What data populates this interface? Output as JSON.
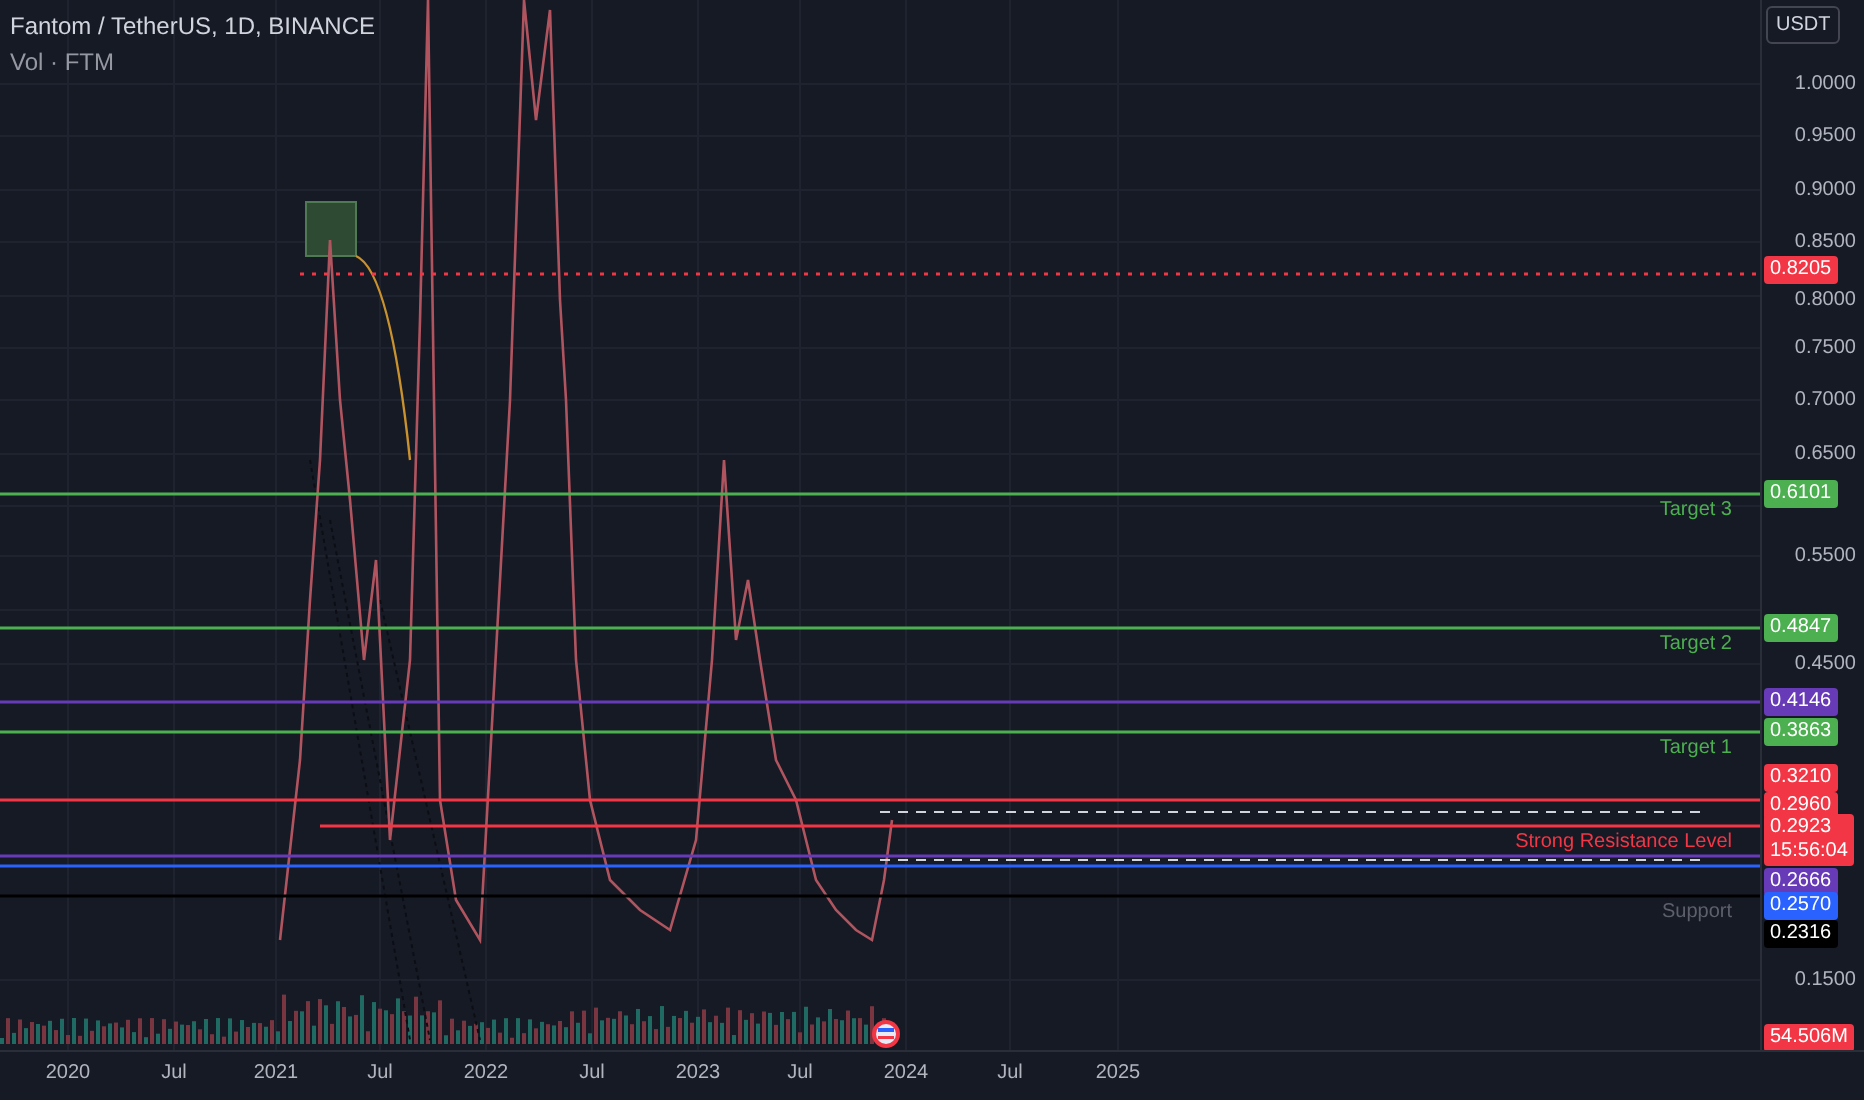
{
  "header": {
    "title": "Fantom / TetherUS, 1D, BINANCE",
    "indicator": "Vol · FTM"
  },
  "currency": "USDT",
  "price_ticks": [
    "1.0000",
    "0.9500",
    "0.9000",
    "0.8500",
    "0.8000",
    "0.7500",
    "0.7000",
    "0.6500",
    "0.5500",
    "0.4500",
    "0.1500"
  ],
  "levels": [
    {
      "price": "0.8205",
      "color": "#f23645",
      "kind": "dotted"
    },
    {
      "price": "0.6101",
      "color": "#4caf50",
      "kind": "solid",
      "caption": "Target 3"
    },
    {
      "price": "0.4847",
      "color": "#4caf50",
      "kind": "solid",
      "caption": "Target 2"
    },
    {
      "price": "0.4146",
      "color": "#673ab7",
      "kind": "solid"
    },
    {
      "price": "0.3863",
      "color": "#4caf50",
      "kind": "solid",
      "caption": "Target 1"
    },
    {
      "price": "0.3210",
      "color": "#f23645",
      "kind": "label"
    },
    {
      "price": "0.2960",
      "color": "#f23645",
      "kind": "solid"
    },
    {
      "price": "0.2923",
      "time": "15:56:04",
      "color": "#f23645",
      "kind": "solid",
      "caption": "Strong Resistance Level"
    },
    {
      "price": "0.2666",
      "color": "#673ab7",
      "kind": "solid"
    },
    {
      "price": "0.2570",
      "color": "#2962ff",
      "kind": "solid"
    },
    {
      "price": "0.2316",
      "color": "#000000",
      "kind": "solid",
      "caption": "Support"
    }
  ],
  "volume_label": {
    "text": "54.506M",
    "color": "#f23645"
  },
  "time_ticks": [
    "2020",
    "Jul",
    "2021",
    "Jul",
    "2022",
    "Jul",
    "2023",
    "Jul",
    "2024",
    "Jul",
    "2025"
  ]
}
